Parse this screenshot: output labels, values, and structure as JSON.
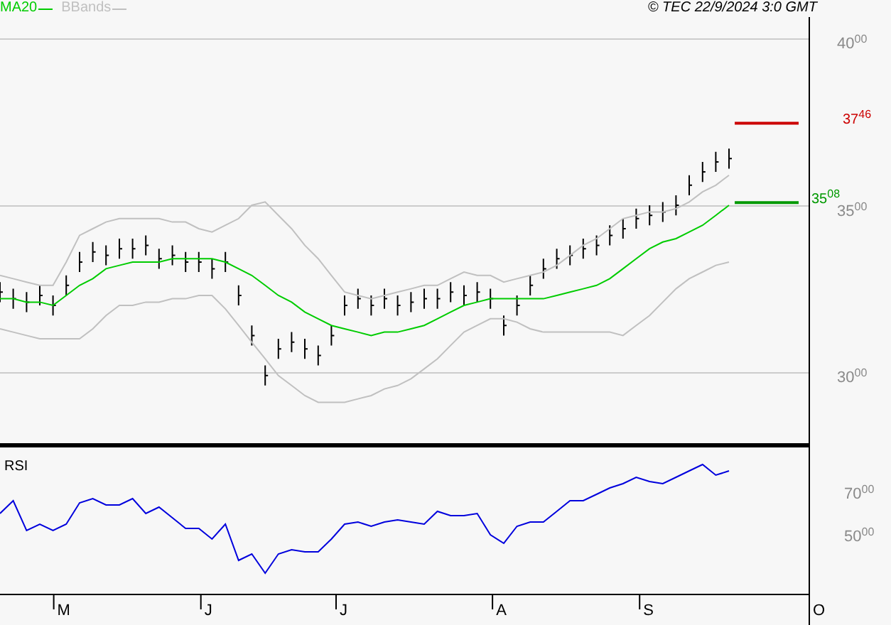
{
  "legend": [
    {
      "label": "MA20",
      "color": "#00cc00"
    },
    {
      "label": "BBands",
      "color": "#c0c0c0"
    }
  ],
  "copyright": "© TEC 22/9/2024 3:0 GMT",
  "price_panel": {
    "y_axis_labels": [
      "40$^{00}$",
      "35$^{00}$",
      "30$^{00}$"
    ],
    "level_labels": [
      {
        "label": "37$^{46}$",
        "color": "#cc0000"
      },
      {
        "label": "35$^{08}$",
        "color": "#009900"
      }
    ]
  },
  "rsi_panel": {
    "title": "RSI",
    "y_axis_labels": [
      "70$^{00}$",
      "50$^{00}$"
    ],
    "month_labels": [
      "M",
      "J",
      "J",
      "A",
      "S",
      "O"
    ]
  }
}
